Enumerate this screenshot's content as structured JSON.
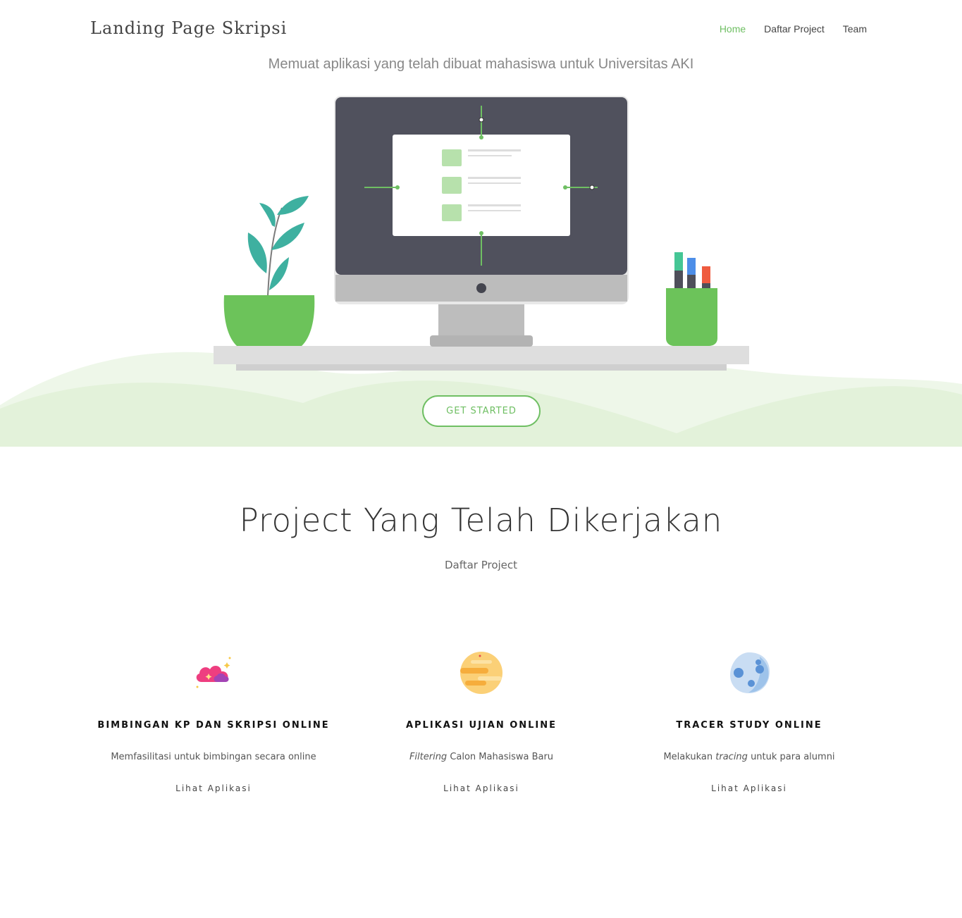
{
  "navbar": {
    "brand": "Landing Page Skripsi",
    "links": [
      {
        "label": "Home",
        "active": true
      },
      {
        "label": "Daftar Project",
        "active": false
      },
      {
        "label": "Team",
        "active": false
      }
    ]
  },
  "hero": {
    "subtitle": "Memuat aplikasi yang telah dibuat mahasiswa untuk Universitas AKI",
    "cta_label": "GET STARTED"
  },
  "projects": {
    "title": "Project Yang Telah Dikerjakan",
    "subtitle": "Daftar Project",
    "items": [
      {
        "icon": "cloud-icon",
        "title": "BIMBINGAN KP DAN SKRIPSI ONLINE",
        "desc_plain_1": "Memfasilitasi untuk bimbingan secara online",
        "desc_em": "",
        "desc_plain_2": "",
        "link": "Lihat Aplikasi"
      },
      {
        "icon": "planet-icon",
        "title": "APLIKASI UJIAN ONLINE",
        "desc_plain_1": "",
        "desc_em": "Filtering",
        "desc_plain_2": " Calon Mahasiswa Baru",
        "link": "Lihat Aplikasi"
      },
      {
        "icon": "moon-icon",
        "title": "TRACER STUDY ONLINE",
        "desc_plain_1": "Melakukan ",
        "desc_em": "tracing",
        "desc_plain_2": " untuk para alumni",
        "link": "Lihat Aplikasi"
      }
    ]
  },
  "colors": {
    "accent": "#6fbf63",
    "hill_light": "#e8f4e1",
    "monitor_dark": "#50515d"
  }
}
